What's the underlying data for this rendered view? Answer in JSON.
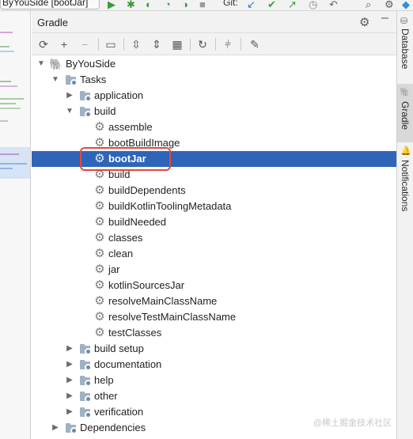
{
  "toolbar": {
    "run_config": "ByYouSide [bootJar]",
    "git_label": "Git:"
  },
  "panel": {
    "title": "Gradle",
    "icons": [
      "refresh-icon",
      "add-icon",
      "remove-icon",
      "show-tasks-icon",
      "expand-all-icon",
      "collapse-all-icon",
      "group-modules-icon",
      "analyze-icon",
      "offline-icon",
      "settings-wrench-icon"
    ]
  },
  "tree": {
    "root": "ByYouSide",
    "tasks": "Tasks",
    "application": "application",
    "build": "build",
    "build_tasks": [
      "assemble",
      "bootBuildImage",
      "bootJar",
      "build",
      "buildDependents",
      "buildKotlinToolingMetadata",
      "buildNeeded",
      "classes",
      "clean",
      "jar",
      "kotlinSourcesJar",
      "resolveMainClassName",
      "resolveTestMainClassName",
      "testClasses"
    ],
    "groups": [
      "build setup",
      "documentation",
      "help",
      "other",
      "verification"
    ],
    "dependencies": "Dependencies",
    "selected": "bootJar"
  },
  "right_tabs": {
    "database": "Database",
    "gradle": "Gradle",
    "notifications": "Notifications"
  },
  "watermark": "@稀土掘金技术社区",
  "colors": {
    "selection": "#2e65b8",
    "highlight_box": "#e0483e"
  }
}
